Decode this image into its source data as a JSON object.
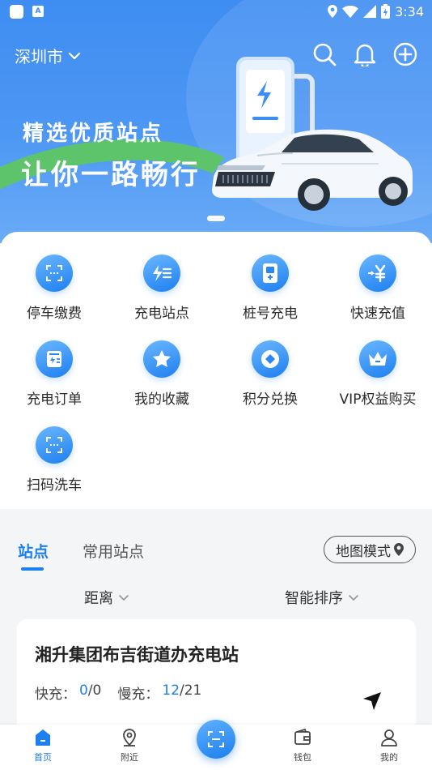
{
  "status_bar": {
    "time": "3:34",
    "app_badge": "A"
  },
  "header": {
    "city": "深圳市"
  },
  "banner": {
    "line1": "精选优质站点",
    "line2": "让你一路畅行",
    "slide_index": 1,
    "slide_count": 1
  },
  "features": [
    {
      "label": "停车缴费",
      "icon": "parking-scan-icon"
    },
    {
      "label": "充电站点",
      "icon": "charging-station-icon"
    },
    {
      "label": "桩号充电",
      "icon": "charger-pile-icon"
    },
    {
      "label": "快速充值",
      "icon": "yen-recharge-icon"
    },
    {
      "label": "充电订单",
      "icon": "order-list-icon"
    },
    {
      "label": "我的收藏",
      "icon": "star-icon"
    },
    {
      "label": "积分兑换",
      "icon": "points-coin-icon"
    },
    {
      "label": "VIP权益购买",
      "icon": "crown-icon"
    },
    {
      "label": "扫码洗车",
      "icon": "car-wash-scan-icon"
    }
  ],
  "tabs": {
    "active": "站点",
    "other": "常用站点"
  },
  "map_mode": {
    "label": "地图模式"
  },
  "sort": {
    "distance": "距离",
    "smart": "智能排序"
  },
  "station": {
    "name": "湘升集团布吉街道办充电站",
    "fast_label": "快充：",
    "fast_available": "0",
    "fast_total": "/0",
    "slow_label": "慢充：",
    "slow_available": "12",
    "slow_total": "/21"
  },
  "bottom_nav": {
    "home": "首页",
    "nearby": "附近",
    "wallet": "钱包",
    "mine": "我的"
  },
  "colors": {
    "accent": "#1e7ff0",
    "banner_blue": "#4d97f4",
    "banner_green": "#5dc46c"
  }
}
